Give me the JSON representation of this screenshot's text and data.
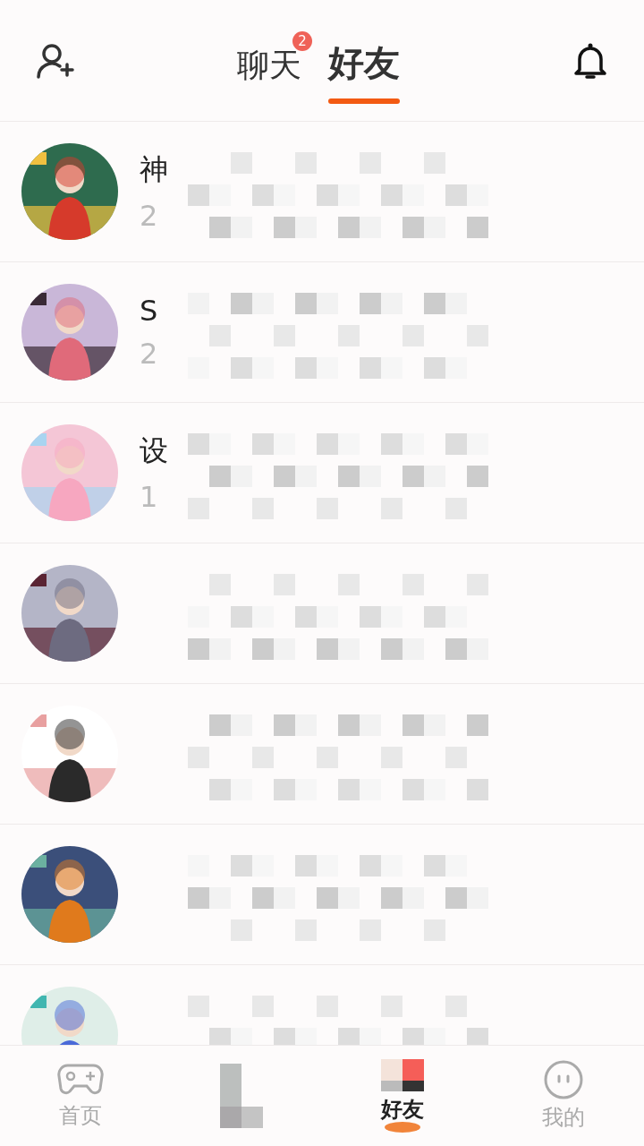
{
  "header": {
    "tabs": [
      {
        "label": "聊天",
        "selected": false,
        "badge": "2"
      },
      {
        "label": "好友",
        "selected": true
      }
    ]
  },
  "friends": [
    {
      "kind": "named",
      "name": "神",
      "subtitle": "2"
    },
    {
      "kind": "named",
      "name": "S",
      "subtitle": "2"
    },
    {
      "kind": "named",
      "name": "设",
      "subtitle": "1"
    },
    {
      "kind": "masked"
    },
    {
      "kind": "masked"
    },
    {
      "kind": "masked"
    },
    {
      "kind": "masked"
    }
  ],
  "bottom_nav": [
    {
      "label": "首页",
      "kind": "game",
      "selected": false
    },
    {
      "kind": "mosaic",
      "selected": false
    },
    {
      "label": "好友",
      "kind": "mosaic-friends",
      "selected": true
    },
    {
      "label": "我的",
      "kind": "face",
      "selected": false
    }
  ]
}
